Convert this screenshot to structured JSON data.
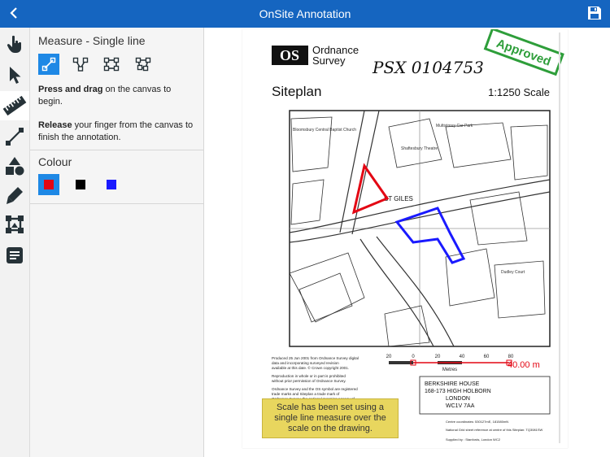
{
  "header": {
    "title": "OnSite Annotation"
  },
  "toolbar": {
    "tools": [
      {
        "icon": "hand-icon"
      },
      {
        "icon": "pointer-icon"
      },
      {
        "icon": "ruler-icon"
      },
      {
        "icon": "line-icon"
      },
      {
        "icon": "shapes-icon"
      },
      {
        "icon": "pen-icon"
      },
      {
        "icon": "crop-icon"
      },
      {
        "icon": "note-icon"
      }
    ],
    "active_index": 2
  },
  "panel": {
    "measure_title": "Measure - Single line",
    "measure_modes": [
      "single-line-icon",
      "multi-line-icon",
      "rectangle-icon",
      "area-icon"
    ],
    "help1_bold": "Press and drag",
    "help1_rest": " on the canvas to begin.",
    "help2_bold": "Release",
    "help2_rest": " your finger from the canvas to finish the annotation.",
    "colour_title": "Colour",
    "colours": [
      {
        "hex": "#e30613",
        "active": true
      },
      {
        "hex": "#000000",
        "active": false
      },
      {
        "hex": "#1a1aff",
        "active": false
      }
    ]
  },
  "document": {
    "brand_line1": "Ordnance",
    "brand_line2": "Survey",
    "logo_text": "OS",
    "handwritten_ref": "PSX 0104753",
    "stamp": "Approved",
    "siteplan_label": "Siteplan",
    "scale_label": "1:1250 Scale",
    "map_label": "ST GILES",
    "measure_value": "40.00 m",
    "scale_ticks": [
      "20",
      "0",
      "20",
      "40",
      "60",
      "80"
    ],
    "scale_units": "Metres",
    "address_lines": [
      "BERKSHIRE HOUSE",
      "168-173 HIGH HOLBORN",
      "LONDON",
      "WC1V 7AA"
    ],
    "map_places": [
      "Bloomsbury Central Baptist Church",
      "Multistorey Car Park",
      "Shaftesbury Theatre",
      "Dudley Court"
    ],
    "small_print": [
      "Produced 25 Jun 2001 from Ordnance Survey digital",
      "data and incorporating surveyed revision",
      "available at this date. © Crown copyright 2001.",
      "Reproduction in whole or in part is prohibited",
      "without prior permission of Ordnance Survey.",
      "Ordnance Survey and the OS symbol are registered",
      "trade marks and Siteplan a trade mark of",
      "Ordnance Survey, the national mapping agency of"
    ],
    "centre_coords": "Centre coordinates: 530127mE, 181580mN",
    "grid_ref": "National Grid sheet reference at centre of this Siteplan: TQ3081SW",
    "supplied_by": "Supplied by : Stanfords, London WC2"
  },
  "tooltip": {
    "text": "Scale has been set using a single line measure over the scale on the drawing."
  },
  "colors": {
    "accent": "#1565c0",
    "selected": "#1e88e5",
    "stamp": "#2e9e3a"
  }
}
